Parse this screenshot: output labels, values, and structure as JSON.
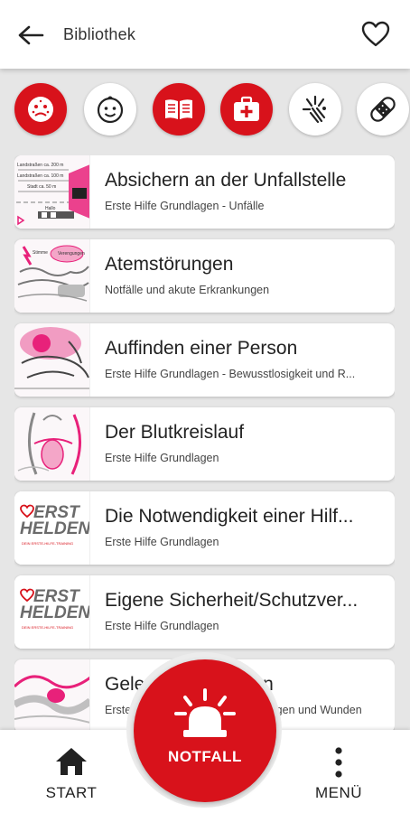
{
  "appbar": {
    "title": "Bibliothek",
    "back_icon": "arrow-left-icon",
    "favorite_icon": "heart-outline-icon"
  },
  "categories": [
    {
      "name": "sick-face-icon",
      "style": "red"
    },
    {
      "name": "child-face-icon",
      "style": "white"
    },
    {
      "name": "book-icon",
      "style": "red"
    },
    {
      "name": "first-aid-kit-icon",
      "style": "red"
    },
    {
      "name": "burst-icon",
      "style": "white"
    },
    {
      "name": "bandage-icon",
      "style": "white"
    }
  ],
  "items": [
    {
      "title": "Absichern an der Unfallstelle",
      "subtitle": "Erste Hilfe Grundlagen - Unfälle"
    },
    {
      "title": "Atemstörungen",
      "subtitle": "Notfälle und akute Erkrankungen"
    },
    {
      "title": "Auffinden einer Person",
      "subtitle": "Erste Hilfe Grundlagen - Bewusstlosigkeit und R..."
    },
    {
      "title": "Der Blutkreislauf",
      "subtitle": "Erste Hilfe Grundlagen"
    },
    {
      "title": "Die Notwendigkeit einer Hilf...",
      "subtitle": "Erste Hilfe Grundlagen"
    },
    {
      "title": "Eigene Sicherheit/Schutzver...",
      "subtitle": "Erste Hilfe Grundlagen"
    },
    {
      "title": "Gelenkverletzungen",
      "subtitle": "Erste Hilfe Grundlagen - Verletzungen und Wunden"
    }
  ],
  "logo": {
    "line1": "ERST",
    "line2": "HELDEN",
    "tagline": "DEIN ERSTE-HILFE-TRAINING"
  },
  "thumb_texts": {
    "road_1": "Landstraßen ca. 200 m",
    "road_2": "Landstraßen ca. 100 m",
    "road_3": "Stadt ca. 50 m",
    "road_4": "Hallo",
    "airway_1": "Stimme",
    "airway_2": "Verengungen"
  },
  "bottom": {
    "start_label": "START",
    "emergency_label": "NOTFALL",
    "menu_label": "MENÜ"
  },
  "colors": {
    "brand_red": "#d8121b",
    "background": "#e6e6e6",
    "accent_pink": "#e8217a"
  }
}
